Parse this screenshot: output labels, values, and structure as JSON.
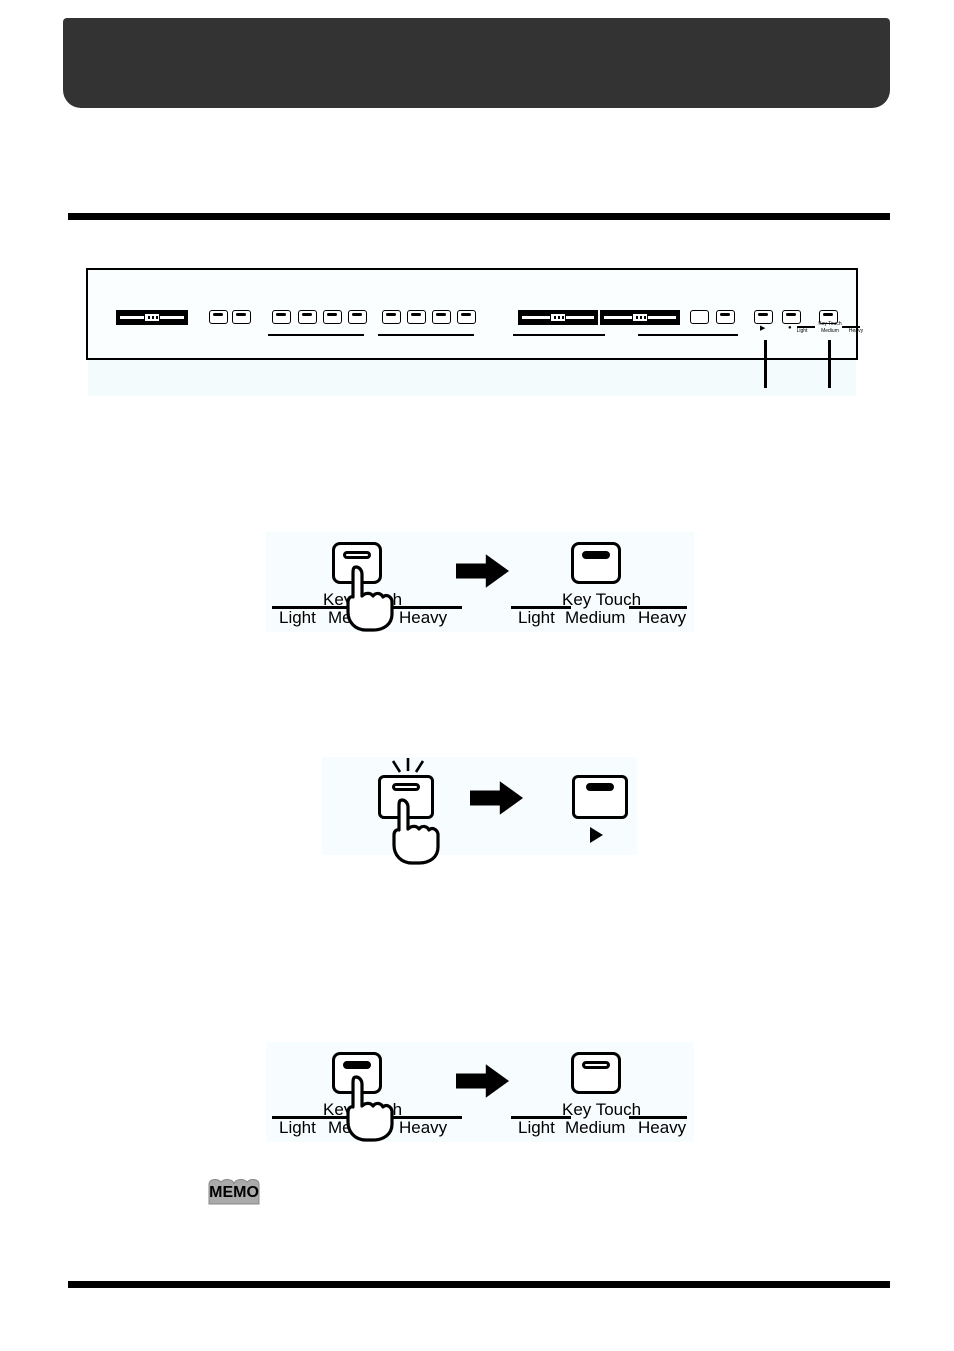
{
  "page": {
    "background_color": "#ffffff",
    "header_color": "#333333",
    "rule_color": "#000000"
  },
  "header": {
    "title": ""
  },
  "panel_figure": {
    "name": "front-panel-diagram",
    "caption": "",
    "tiny_labels": {
      "key_touch": "Key Touch",
      "light": "Light",
      "medium": "Medium",
      "heavy": "Heavy",
      "play_triangle": "▶",
      "rec_dot": "●"
    },
    "controls": [
      {
        "type": "slider",
        "name": "volume-slider"
      },
      {
        "type": "button",
        "name": "panel-button-1"
      },
      {
        "type": "button",
        "name": "panel-button-2"
      },
      {
        "type": "button",
        "name": "tone-button-1"
      },
      {
        "type": "button",
        "name": "tone-button-2"
      },
      {
        "type": "button",
        "name": "tone-button-3"
      },
      {
        "type": "button",
        "name": "tone-button-4"
      },
      {
        "type": "button",
        "name": "tone-button-5"
      },
      {
        "type": "button",
        "name": "tone-button-6"
      },
      {
        "type": "button",
        "name": "tone-button-7"
      },
      {
        "type": "button",
        "name": "tone-button-8"
      },
      {
        "type": "slider",
        "name": "balance-slider-1"
      },
      {
        "type": "slider",
        "name": "balance-slider-2"
      },
      {
        "type": "button",
        "name": "panel-button-plain"
      },
      {
        "type": "button",
        "name": "panel-button-3"
      },
      {
        "type": "button",
        "name": "play-button"
      },
      {
        "type": "button",
        "name": "rec-button"
      },
      {
        "type": "button",
        "name": "key-touch-button"
      }
    ]
  },
  "figures": [
    {
      "name": "figure-key-touch-press-1",
      "before": {
        "button_name": "key-touch-button",
        "led_state": "off",
        "caption": "Key Touch",
        "labels": [
          "Light",
          "Medium",
          "Heavy"
        ]
      },
      "arrow": "➡",
      "after": {
        "button_name": "key-touch-button",
        "led_state": "on",
        "caption": "Key Touch",
        "labels": [
          "Light",
          "Medium",
          "Heavy"
        ]
      }
    },
    {
      "name": "figure-button-press-lit",
      "before": {
        "button_name": "panel-button",
        "led_state": "lit",
        "caption": "",
        "labels": []
      },
      "arrow": "➡",
      "after": {
        "button_name": "panel-button",
        "led_state": "on",
        "caption": "",
        "marker": "▶",
        "labels": []
      }
    },
    {
      "name": "figure-key-touch-press-2",
      "before": {
        "button_name": "key-touch-button",
        "led_state": "on",
        "caption": "Key Touch",
        "labels": [
          "Light",
          "Medium",
          "Heavy"
        ]
      },
      "arrow": "➡",
      "after": {
        "button_name": "key-touch-button",
        "led_state": "off",
        "caption": "Key Touch",
        "labels": [
          "Light",
          "Medium",
          "Heavy"
        ]
      }
    }
  ],
  "memo": {
    "label": "MEMO",
    "icon": "open-book-icon",
    "body": ""
  }
}
